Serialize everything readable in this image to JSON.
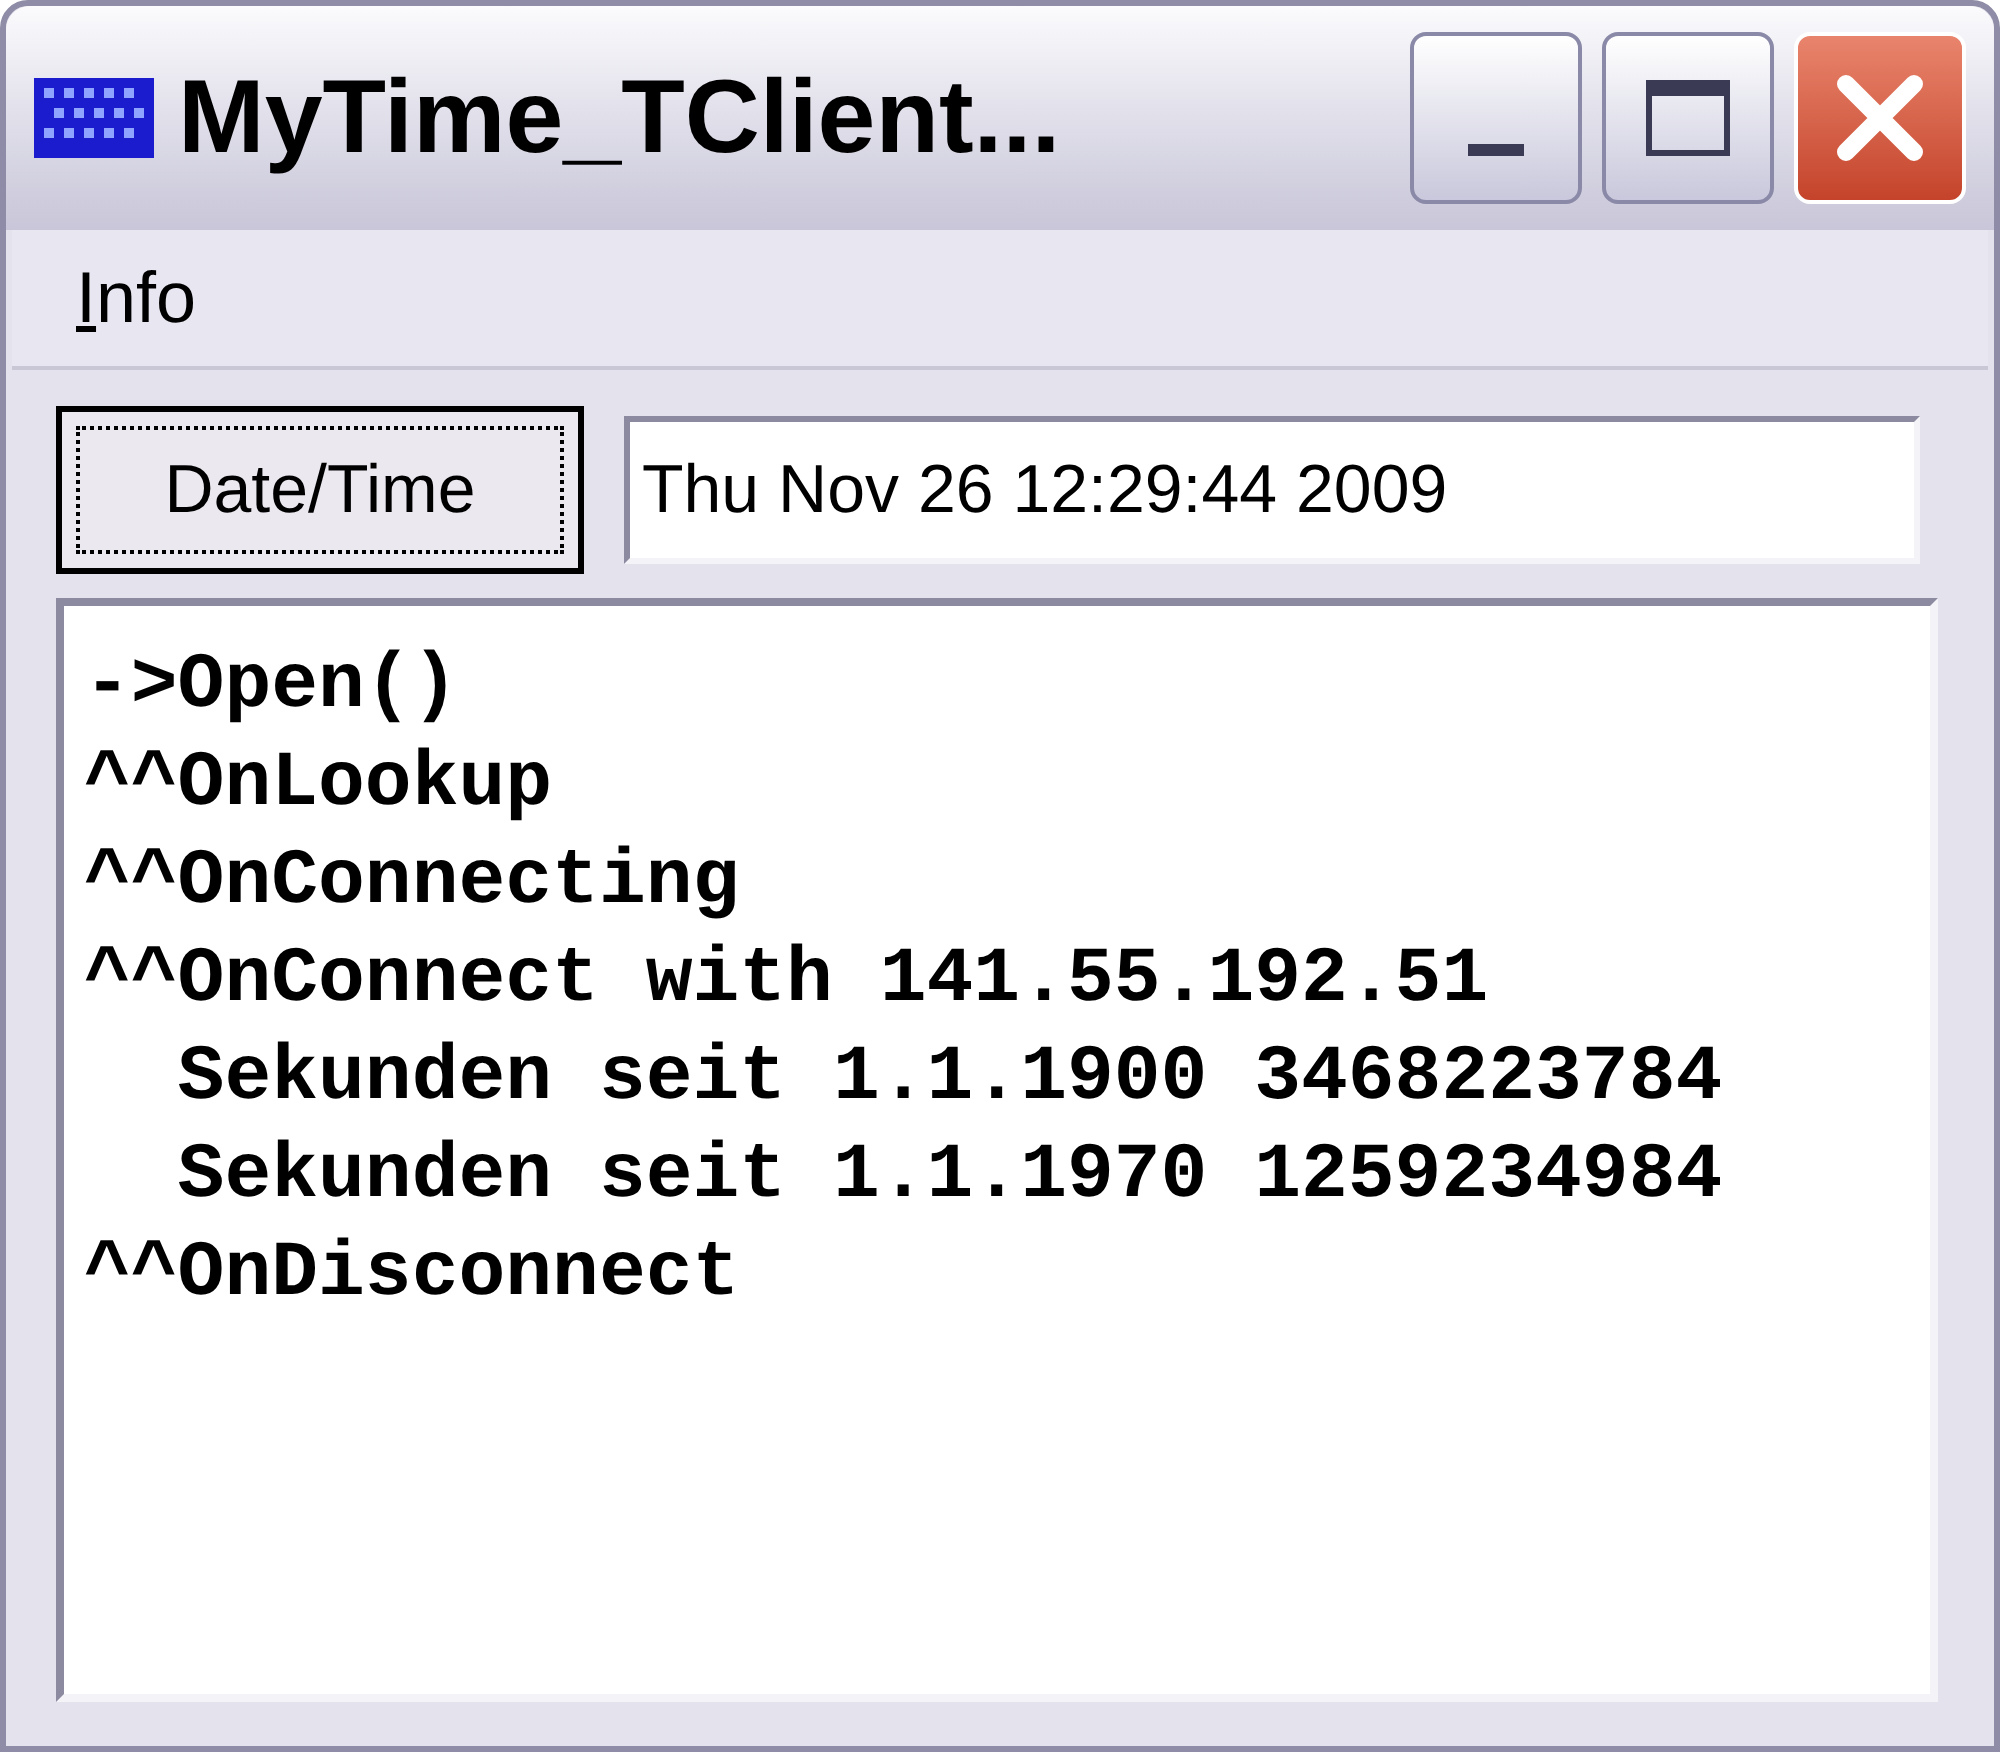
{
  "window": {
    "title": "MyTime_TClient..."
  },
  "menu": [
    "Info"
  ],
  "button": "Date/Time",
  "field": {
    "value": "Thu Nov 26 12:29:44 2009"
  },
  "log": [
    "->Open()",
    "^^OnLookup",
    "^^OnConnecting",
    "^^OnConnect with 141.55.192.51",
    "  Sekunden seit 1.1.1900 3468223784",
    "  Sekunden seit 1.1.1970 1259234984",
    "^^OnDisconnect"
  ]
}
